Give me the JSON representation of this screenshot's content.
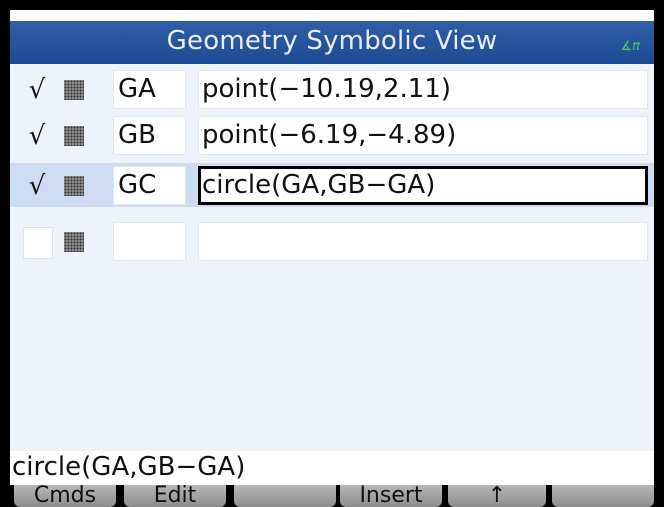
{
  "title": "Geometry Symbolic View",
  "angle_mode_indicator": "∡π",
  "rows": [
    {
      "checked": "√",
      "name": "GA",
      "expression": "point(−10.19,2.11)"
    },
    {
      "checked": "√",
      "name": "GB",
      "expression": "point(−6.19,−4.89)"
    },
    {
      "checked": "√",
      "name": "GC",
      "expression": "circle(GA,GB−GA)"
    },
    {
      "checked": "",
      "name": "",
      "expression": ""
    }
  ],
  "edit_line": "circle(GA,GB−GA)",
  "menu": {
    "cmds": "Cmds",
    "edit": "Edit",
    "blank1": "",
    "insert": "Insert",
    "up_arrow": "↑",
    "blank2": ""
  },
  "colors": {
    "titlebar": "#1d4a94",
    "selected_row": "#cddcf0",
    "angle_indicator": "#4cd04c"
  }
}
